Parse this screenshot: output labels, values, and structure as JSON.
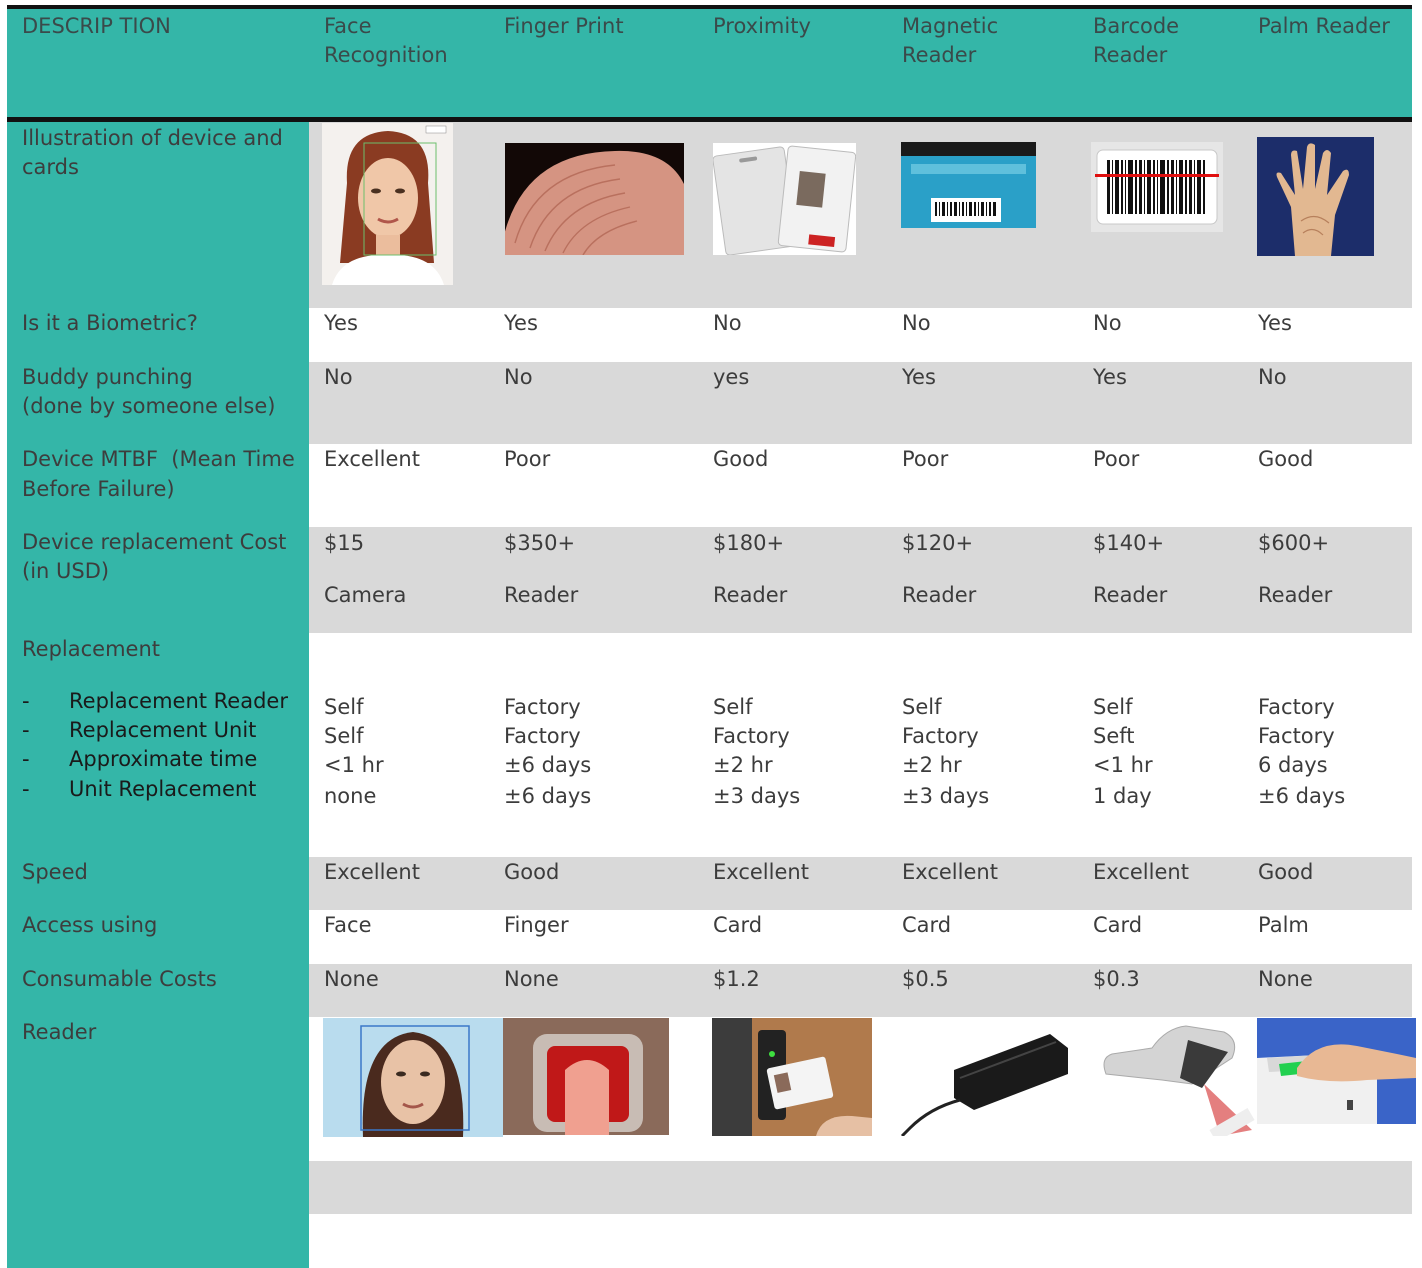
{
  "header": {
    "description": "DESCRIP TION",
    "columns": [
      {
        "line1": "Face",
        "line2": "Recognition"
      },
      {
        "line1": "Finger Print",
        "line2": ""
      },
      {
        "line1": "Proximity",
        "line2": ""
      },
      {
        "line1": "Magnetic",
        "line2": "Reader"
      },
      {
        "line1": "Barcode",
        "line2": "Reader"
      },
      {
        "line1": "Palm Reader",
        "line2": ""
      }
    ]
  },
  "rows": {
    "illustration": {
      "label1": "Illustration of device and",
      "label2": "cards"
    },
    "biometric": {
      "label": "Is it a Biometric?",
      "values": [
        "Yes",
        "Yes",
        "No",
        "No",
        "No",
        "Yes"
      ]
    },
    "buddy": {
      "label1": "Buddy punching",
      "label2": "(done by someone else)",
      "values": [
        "No",
        "No",
        "yes",
        "Yes",
        "Yes",
        "No"
      ]
    },
    "mtbf": {
      "label1": "Device MTBF  (Mean Time",
      "label2": "Before Failure)",
      "values": [
        "Excellent",
        "Poor",
        "Good",
        "Poor",
        "Poor",
        "Good"
      ]
    },
    "cost": {
      "label1": "Device replacement Cost",
      "label2": "(in USD)",
      "prices": [
        "$15",
        "$350+",
        "$180+",
        "$120+",
        "$140+",
        "$600+"
      ],
      "units": [
        "Camera",
        "Reader",
        "Reader",
        "Reader",
        "Reader",
        "Reader"
      ]
    },
    "replacement": {
      "label": "Replacement",
      "bullets": [
        "Replacement Reader",
        "Replacement Unit",
        "Approximate time",
        "Unit Replacement"
      ],
      "reader": [
        "Self",
        "Factory",
        "Self",
        "Self",
        "Self",
        "Factory"
      ],
      "unit": [
        "Self",
        "Factory",
        "Factory",
        "Factory",
        "Seft",
        "Factory"
      ],
      "time": [
        "<1 hr",
        "±6 days",
        "±2 hr",
        "±2 hr",
        "<1 hr",
        "6 days"
      ],
      "unit_replacement": [
        "none",
        "±6 days",
        "±3 days",
        "±3 days",
        "1 day",
        "±6 days"
      ]
    },
    "speed": {
      "label": "Speed",
      "values": [
        "Excellent",
        "Good",
        "Excellent",
        "Excellent",
        "Excellent",
        "Good"
      ]
    },
    "access": {
      "label": "Access using",
      "values": [
        "Face",
        "Finger",
        "Card",
        "Card",
        "Card",
        "Palm"
      ]
    },
    "consumable": {
      "label": "Consumable Costs",
      "values": [
        "None",
        "None",
        "$1.2",
        "$0.5",
        "$0.3",
        "None"
      ]
    },
    "reader": {
      "label": "Reader"
    }
  },
  "colors": {
    "teal": "#34b6a8",
    "band": "#d9d9d9",
    "rule": "#111111"
  },
  "icons": [
    "face-photo",
    "fingerprint-photo",
    "proximity-card-photo",
    "magnetic-card-photo",
    "barcode-label-photo",
    "palm-scan-photo",
    "face-scan-reader-photo",
    "finger-reader-photo",
    "prox-reader-photo",
    "mag-swipe-reader-photo",
    "barcode-scanner-photo",
    "palm-reader-device-photo"
  ]
}
